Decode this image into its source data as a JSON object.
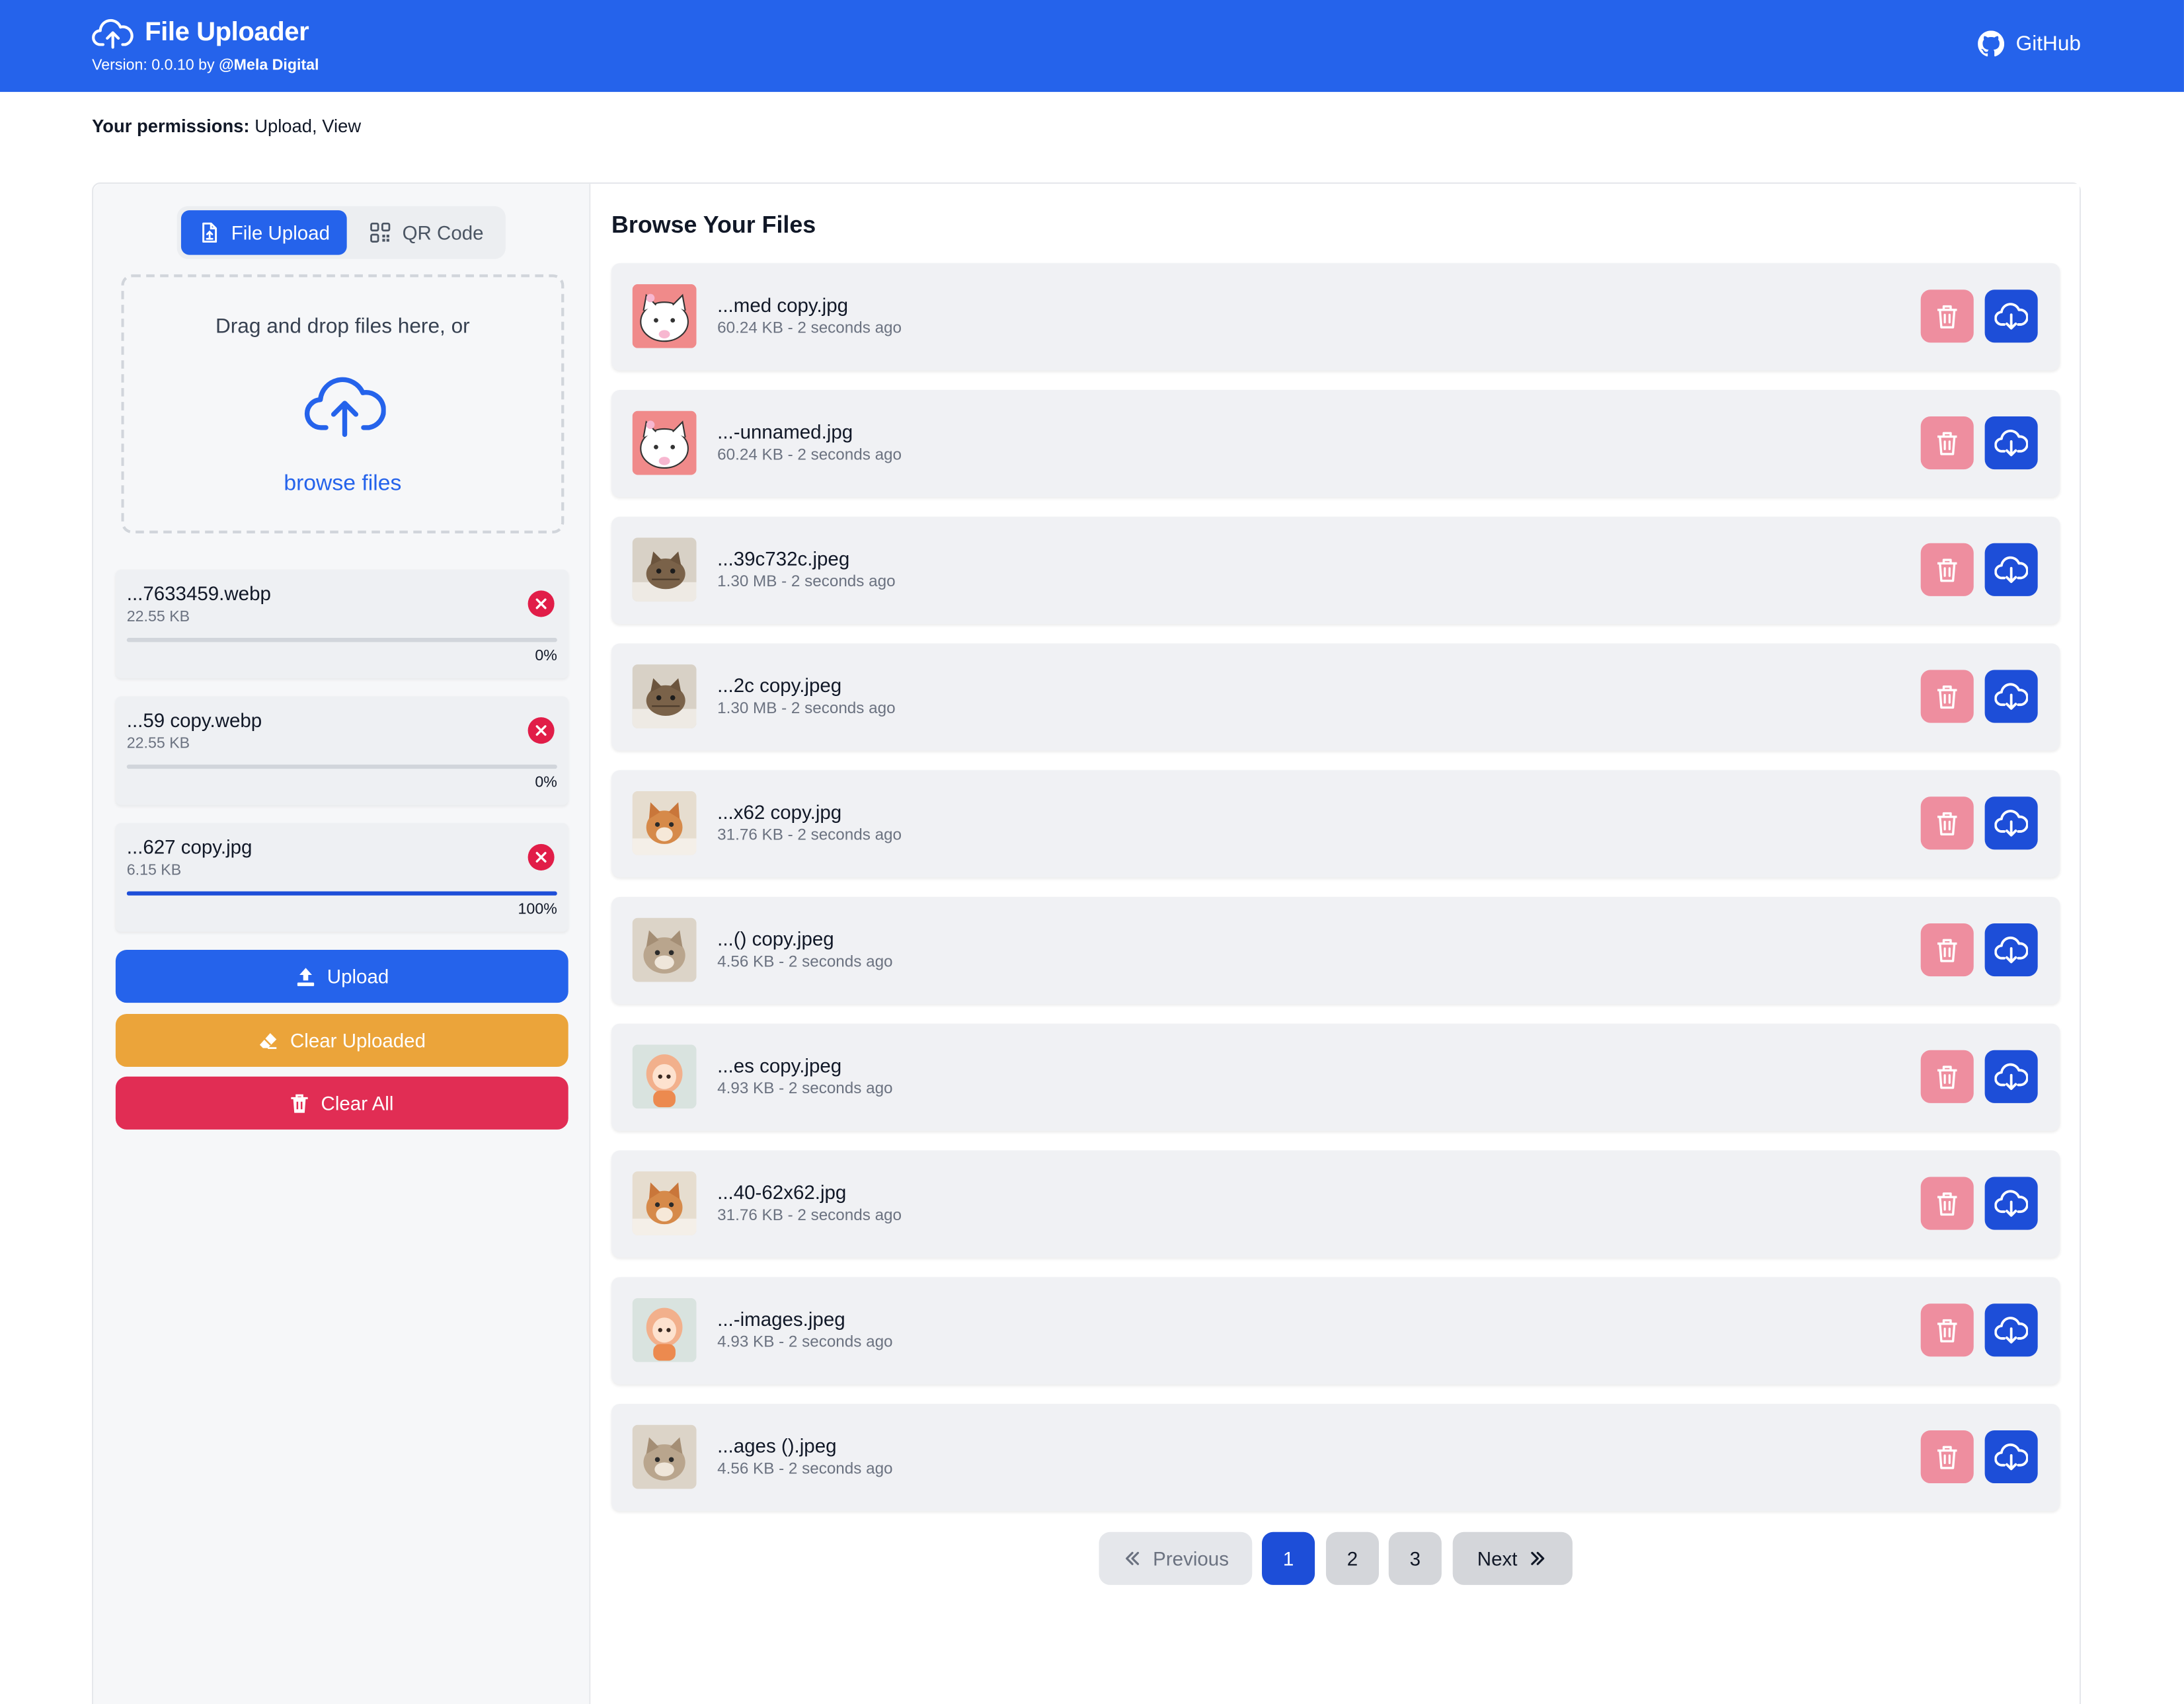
{
  "header": {
    "title": "File Uploader",
    "version_prefix": "Version: 0.0.10 by ",
    "author": "@Mela Digital",
    "github_label": "GitHub",
    "icons": {
      "logo": "cloud-upload-icon",
      "github": "github-icon"
    }
  },
  "permissions": {
    "label": "Your permissions:",
    "value": "Upload, View"
  },
  "tabs": [
    {
      "label": "File Upload",
      "icon": "file-upload-icon",
      "active": true
    },
    {
      "label": "QR Code",
      "icon": "qr-code-icon",
      "active": false
    }
  ],
  "dropzone": {
    "text": "Drag and drop files here, or",
    "browse": "browse files"
  },
  "queue": [
    {
      "name": "...7633459.webp",
      "size": "22.55 KB",
      "progress": 0,
      "percent": "0%"
    },
    {
      "name": "...59 copy.webp",
      "size": "22.55 KB",
      "progress": 0,
      "percent": "0%"
    },
    {
      "name": "...627 copy.jpg",
      "size": "6.15 KB",
      "progress": 1,
      "percent": "100%"
    }
  ],
  "actions": {
    "upload": "Upload",
    "clear_uploaded": "Clear Uploaded",
    "clear_all": "Clear All"
  },
  "browse": {
    "title": "Browse Your Files",
    "files": [
      {
        "name": "...med copy.jpg",
        "meta": "60.24 KB - 2 seconds ago",
        "thumb": "cat-cartoon"
      },
      {
        "name": "...-unnamed.jpg",
        "meta": "60.24 KB - 2 seconds ago",
        "thumb": "cat-cartoon"
      },
      {
        "name": "...39c732c.jpeg",
        "meta": "1.30 MB - 2 seconds ago",
        "thumb": "tabby-kitten"
      },
      {
        "name": "...2c copy.jpeg",
        "meta": "1.30 MB - 2 seconds ago",
        "thumb": "tabby-kitten"
      },
      {
        "name": "...x62 copy.jpg",
        "meta": "31.76 KB - 2 seconds ago",
        "thumb": "orange-kitten"
      },
      {
        "name": "...() copy.jpeg",
        "meta": "4.56 KB - 2 seconds ago",
        "thumb": "fluffy-kitten"
      },
      {
        "name": "...es copy.jpeg",
        "meta": "4.93 KB - 2 seconds ago",
        "thumb": "doll-figure"
      },
      {
        "name": "...40-62x62.jpg",
        "meta": "31.76 KB - 2 seconds ago",
        "thumb": "orange-kitten"
      },
      {
        "name": "...-images.jpeg",
        "meta": "4.93 KB - 2 seconds ago",
        "thumb": "doll-figure"
      },
      {
        "name": "...ages ().jpeg",
        "meta": "4.56 KB - 2 seconds ago",
        "thumb": "fluffy-kitten"
      }
    ]
  },
  "pagination": {
    "previous": "Previous",
    "next": "Next",
    "pages": [
      "1",
      "2",
      "3"
    ],
    "current": "1"
  },
  "colors": {
    "primary": "#2563eb",
    "upload_button": "#2563eb",
    "clear_uploaded_button": "#eba43a",
    "clear_all_button": "#e12d54",
    "delete_button": "#ee8e9f",
    "download_button": "#1d4ed8",
    "remove_badge": "#e11d48"
  }
}
